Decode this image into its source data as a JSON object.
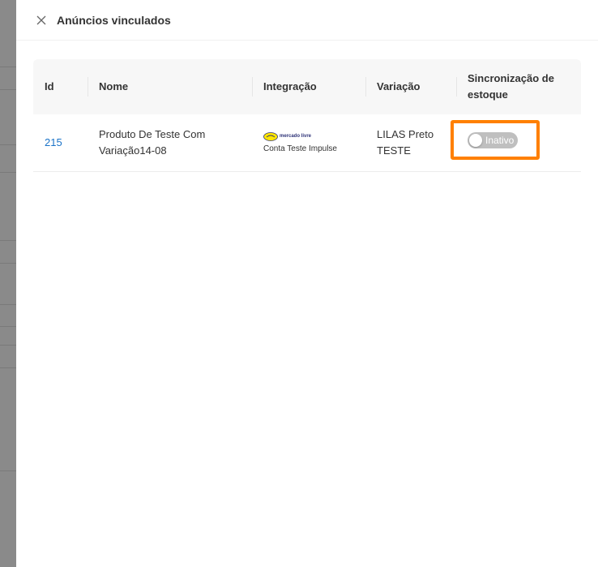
{
  "drawer": {
    "title": "Anúncios vinculados"
  },
  "table": {
    "columns": {
      "id": "Id",
      "nome": "Nome",
      "integracao": "Integração",
      "variacao": "Variação",
      "sincronizacao": "Sincronização de estoque"
    },
    "rows": [
      {
        "id": "215",
        "nome": "Produto De Teste Com Variação14-08",
        "integracao_logo": "mercado livre",
        "integracao_conta": "Conta Teste Impulse",
        "variacao": "LILAS Preto TESTE",
        "sync_label": "Inativo"
      }
    ]
  },
  "theme": {
    "accent": "#ff8000",
    "link": "#1a73c8",
    "toggle_off": "#bfbfbf"
  },
  "icons": {
    "close": "close-icon",
    "integration": "mercado-livre-logo-icon"
  }
}
